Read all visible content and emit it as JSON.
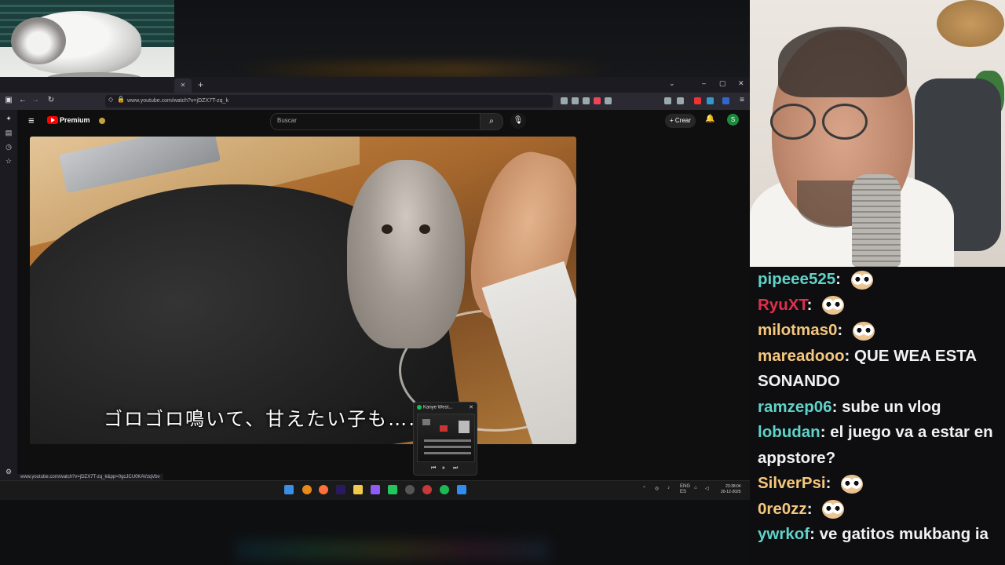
{
  "browser": {
    "address": "www.youtube.com/watch?v=jDZX7T-zq_k",
    "status_url": "www.youtube.com/watch?v=jDZX7T-zq_k&pp=0gcJCU0KAVzqVbv",
    "new_tab": "+",
    "controls": [
      "⌄",
      "–",
      "▢",
      "✕"
    ]
  },
  "youtube": {
    "menu_icon": "hamburger-icon",
    "brand": "Premium",
    "search_placeholder": "Buscar",
    "create_label": "+ Crear",
    "avatar_letter": "S",
    "video": {
      "subtitle": "ゴロゴロ鳴いて、甘えたい子も……"
    }
  },
  "spotify_mini": {
    "title": "Kanye West...",
    "close": "✕",
    "prev": "⏮",
    "pause": "⏸",
    "next": "⏭"
  },
  "taskbar": {
    "lang": "ENG",
    "region": "ES",
    "time": "23:38:04",
    "date": "20-12-2025"
  },
  "chat": {
    "messages": [
      {
        "user": "pipeee525",
        "color": "#5fd3c9",
        "text": "",
        "emote": true
      },
      {
        "user": "RyuXT",
        "color": "#e0304d",
        "text": "",
        "emote": true
      },
      {
        "user": "milotmas0",
        "color": "#f5c77e",
        "text": "",
        "emote": true
      },
      {
        "user": "mareadooo",
        "color": "#f5c77e",
        "text": "QUE WEA ESTA SONANDO",
        "emote": false
      },
      {
        "user": "ramzep06",
        "color": "#5fd3c9",
        "text": "sube un vlog",
        "emote": false
      },
      {
        "user": "lobudan",
        "color": "#5fd3c9",
        "text": "el juego va a estar en appstore?",
        "emote": false
      },
      {
        "user": "SilverPsi",
        "color": "#f5c77e",
        "text": "",
        "emote": true
      },
      {
        "user": "0re0zz",
        "color": "#f5c77e",
        "text": "",
        "emote": true
      },
      {
        "user": "ywrkof",
        "color": "#5fd3c9",
        "text": "ve gatitos mukbang ia",
        "emote": false
      }
    ]
  }
}
